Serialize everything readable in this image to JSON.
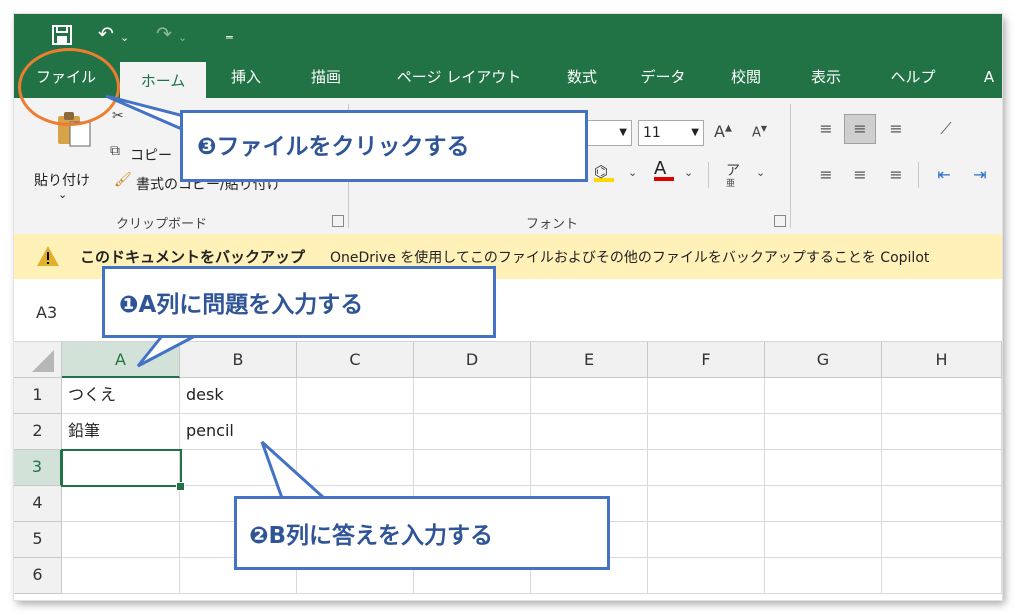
{
  "quick_access": {
    "save_icon": "save-icon",
    "undo_icon": "undo-icon",
    "redo_icon": "redo-icon",
    "customize_icon": "customize-qat-icon"
  },
  "tabs": [
    {
      "label": "ファイル"
    },
    {
      "label": "ホーム"
    },
    {
      "label": "挿入"
    },
    {
      "label": "描画"
    },
    {
      "label": "ページ レイアウト"
    },
    {
      "label": "数式"
    },
    {
      "label": "データ"
    },
    {
      "label": "校閲"
    },
    {
      "label": "表示"
    },
    {
      "label": "ヘルプ"
    },
    {
      "label": "A"
    }
  ],
  "ribbon": {
    "paste_label": "貼り付け",
    "copy_label": "コピー",
    "format_painter_label": "書式のコピー/貼り付け",
    "clipboard_group": "クリップボード",
    "font_group": "フォント",
    "font_size": "11"
  },
  "message_bar": {
    "title": "このドキュメントをバックアップ",
    "text": "OneDrive を使用してこのファイルおよびその他のファイルをバックアップすることを Copilot"
  },
  "name_box": "A3",
  "sheet": {
    "columns": [
      "A",
      "B",
      "C",
      "D",
      "E",
      "F",
      "G",
      "H"
    ],
    "rows": [
      "1",
      "2",
      "3",
      "4",
      "5",
      "6"
    ],
    "cells": [
      [
        "つくえ",
        "desk"
      ],
      [
        "鉛筆",
        "pencil"
      ]
    ]
  },
  "callouts": {
    "step1": "❶A列に問題を入力する",
    "step2": "❷B列に答えを入力する",
    "step3": "❸ファイルをクリックする"
  },
  "colors": {
    "excel_green": "#217346",
    "callout_blue": "#4472c4",
    "highlight_orange": "#ed7d31",
    "message_yellow": "#fff1b8"
  }
}
